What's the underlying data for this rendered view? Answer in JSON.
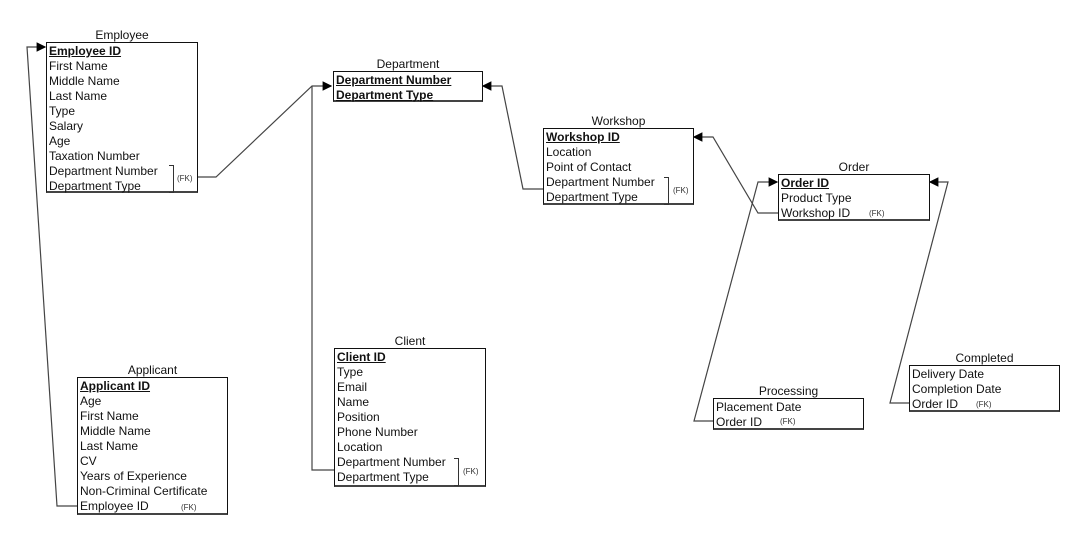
{
  "entities": {
    "employee": {
      "name": "Employee",
      "attributes": [
        "Employee ID",
        "First Name",
        "Middle Name",
        "Last Name",
        "Type",
        "Salary",
        "Age",
        "Taxation Number",
        "Department Number",
        "Department Type"
      ],
      "primary_key": [
        "Employee ID"
      ],
      "fk_label": "(FK)"
    },
    "department": {
      "name": "Department",
      "attributes": [
        "Department Number",
        "Department Type"
      ],
      "primary_key": [
        "Department Number",
        "Department Type"
      ]
    },
    "workshop": {
      "name": "Workshop",
      "attributes": [
        "Workshop ID",
        "Location",
        "Point of Contact",
        "Department Number",
        "Department Type"
      ],
      "primary_key": [
        "Workshop ID"
      ],
      "fk_label": "(FK)"
    },
    "order": {
      "name": "Order",
      "attributes": [
        "Order ID",
        "Product Type",
        "Workshop ID"
      ],
      "primary_key": [
        "Order ID"
      ],
      "fk_label": "(FK)"
    },
    "applicant": {
      "name": "Applicant",
      "attributes": [
        "Applicant ID",
        "Age",
        "First Name",
        "Middle Name",
        "Last Name",
        "CV",
        "Years of Experience",
        "Non-Criminal Certificate",
        "Employee ID"
      ],
      "primary_key": [
        "Applicant ID"
      ],
      "fk_label": "(FK)"
    },
    "client": {
      "name": "Client",
      "attributes": [
        "Client ID",
        "Type",
        "Email",
        "Name",
        "Position",
        "Phone Number",
        "Location",
        "Department Number",
        "Department Type"
      ],
      "primary_key": [
        "Client ID"
      ],
      "fk_label": "(FK)"
    },
    "processing": {
      "name": "Processing",
      "attributes": [
        "Placement Date",
        "Order ID"
      ],
      "primary_key": [],
      "fk_label": "(FK)"
    },
    "completed": {
      "name": "Completed",
      "attributes": [
        "Delivery Date",
        "Completion Date",
        "Order ID"
      ],
      "primary_key": [],
      "fk_label": "(FK)"
    }
  },
  "relationships": [
    {
      "from": "Employee.Department Number/Department Type",
      "to": "Department"
    },
    {
      "from": "Client.Department Number/Department Type",
      "to": "Department"
    },
    {
      "from": "Workshop.Department Number/Department Type",
      "to": "Department"
    },
    {
      "from": "Order.Workshop ID",
      "to": "Workshop"
    },
    {
      "from": "Applicant.Employee ID",
      "to": "Employee"
    },
    {
      "from": "Processing.Order ID",
      "to": "Order"
    },
    {
      "from": "Completed.Order ID",
      "to": "Order"
    }
  ]
}
